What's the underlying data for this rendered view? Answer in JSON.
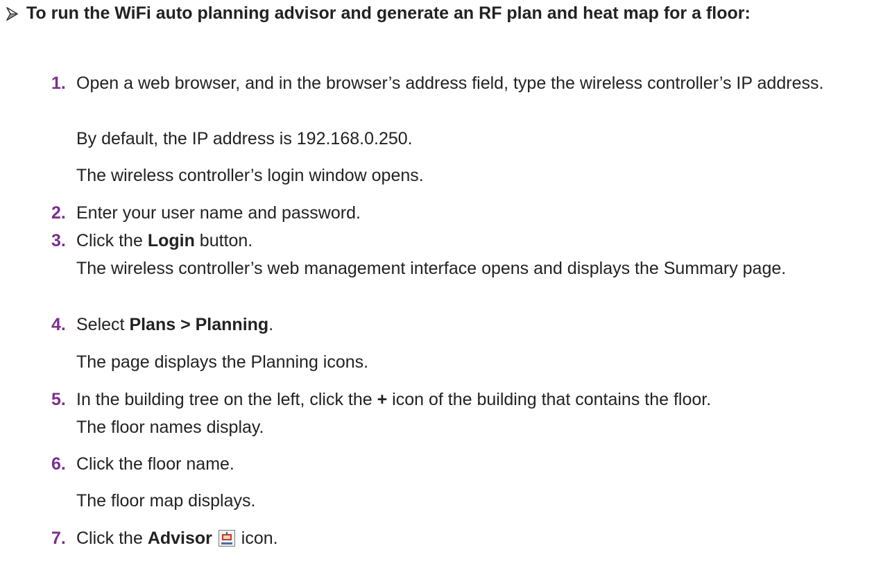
{
  "heading": "To run the WiFi auto planning advisor and generate an RF plan and heat map for a floor:",
  "steps": [
    {
      "num": "1.",
      "text": "Open a web browser, and in the browser’s address field, type the wireless controller’s IP address."
    },
    {
      "num": "2.",
      "text": "Enter your user name and password."
    },
    {
      "num": "3.",
      "pre": "Click the ",
      "bold": "Login",
      "post": " button."
    },
    {
      "num": "4.",
      "pre": "Select ",
      "bold": "Plans > Planning",
      "post": "."
    },
    {
      "num": "5.",
      "pre": "In the building tree on the left, click the ",
      "bold": "+",
      "post": " icon of the building that contains the floor."
    },
    {
      "num": "6.",
      "text": "Click the floor name."
    },
    {
      "num": "7.",
      "pre": "Click the ",
      "bold": "Advisor",
      "post": " icon."
    }
  ],
  "results": {
    "r1a": "By default, the IP address is 192.168.0.250.",
    "r1b": "The wireless controller’s login window opens.",
    "r3": "The wireless controller’s web management interface opens and displays the Summary page.",
    "r4": "The page displays the Planning icons.",
    "r5": "The floor names display.",
    "r6": "The floor map displays."
  },
  "icon": {
    "advisor_label": "Advisor"
  },
  "colors": {
    "step_number": "#7b2f8e",
    "text": "#222222"
  }
}
